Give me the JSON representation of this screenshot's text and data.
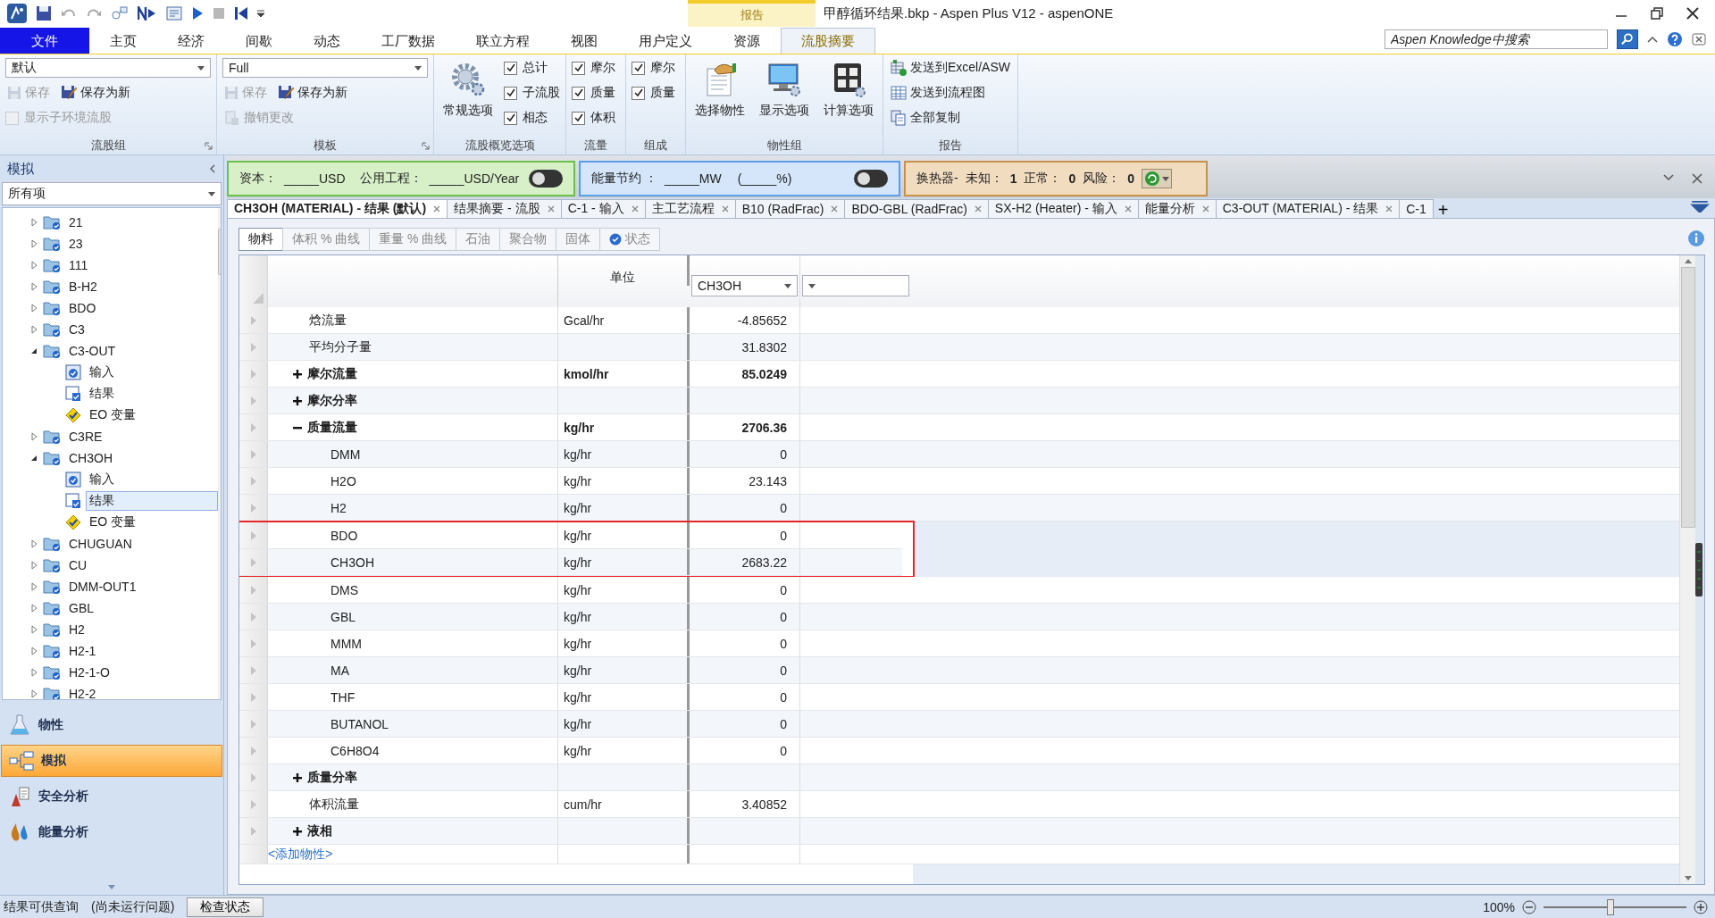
{
  "app_bar": {
    "title": "甲醇循环结果.bkp - Aspen Plus V12 - aspenONE",
    "contextual_tab": "报告"
  },
  "menu_tabs": [
    {
      "label": "文件",
      "kind": "file",
      "selected": false
    },
    {
      "label": "主页",
      "kind": "tab",
      "selected": false
    },
    {
      "label": "经济",
      "kind": "tab",
      "selected": false
    },
    {
      "label": "间歇",
      "kind": "tab",
      "selected": false
    },
    {
      "label": "动态",
      "kind": "tab",
      "selected": false
    },
    {
      "label": "工厂数据",
      "kind": "tab",
      "selected": false
    },
    {
      "label": "联立方程",
      "kind": "tab",
      "selected": false
    },
    {
      "label": "视图",
      "kind": "tab",
      "selected": false
    },
    {
      "label": "用户定义",
      "kind": "tab",
      "selected": false
    },
    {
      "label": "资源",
      "kind": "tab",
      "selected": false
    },
    {
      "label": "流股摘要",
      "kind": "tab",
      "selected": true
    }
  ],
  "search": {
    "placeholder": "Aspen Knowledge中搜索"
  },
  "ribbon": {
    "groups": [
      {
        "title": "流股组",
        "launcher": true,
        "columns": [
          [
            {
              "kind": "dropdown",
              "value": "默认"
            },
            {
              "kind": "button_row",
              "items": [
                {
                  "kind": "button",
                  "label": "保存",
                  "disabled": true
                },
                {
                  "kind": "button",
                  "label": "保存为新",
                  "disabled": false
                }
              ]
            },
            {
              "kind": "checkbox",
              "label": "显示子环境流股",
              "checked": false,
              "disabled": true
            }
          ]
        ]
      },
      {
        "title": "模板",
        "launcher": true,
        "columns": [
          [
            {
              "kind": "dropdown",
              "value": "Full"
            },
            {
              "kind": "button_row",
              "items": [
                {
                  "kind": "button",
                  "label": "保存",
                  "disabled": true
                },
                {
                  "kind": "button",
                  "label": "保存为新",
                  "disabled": false
                }
              ]
            },
            {
              "kind": "button",
              "label": "撤销更改",
              "disabled": true
            }
          ]
        ]
      },
      {
        "title": "流股概览选项",
        "launcher": false,
        "columns": [
          [
            {
              "kind": "large_button",
              "label": "常规选项"
            }
          ],
          [
            {
              "kind": "checkbox",
              "label": "总计",
              "checked": true,
              "disabled": false
            },
            {
              "kind": "checkbox",
              "label": "子流股",
              "checked": true,
              "disabled": false
            },
            {
              "kind": "checkbox",
              "label": "相态",
              "checked": true,
              "disabled": false
            }
          ]
        ]
      },
      {
        "title": "流量",
        "launcher": false,
        "columns": [
          [
            {
              "kind": "checkbox",
              "label": "摩尔",
              "checked": true,
              "disabled": false
            },
            {
              "kind": "checkbox",
              "label": "质量",
              "checked": true,
              "disabled": false
            },
            {
              "kind": "checkbox",
              "label": "体积",
              "checked": true,
              "disabled": false
            }
          ]
        ]
      },
      {
        "title": "组成",
        "launcher": false,
        "columns": [
          [
            {
              "kind": "checkbox",
              "label": "摩尔",
              "checked": true,
              "disabled": false
            },
            {
              "kind": "checkbox",
              "label": "质量",
              "checked": true,
              "disabled": false
            }
          ]
        ]
      },
      {
        "title": "物性组",
        "launcher": false,
        "columns": [
          [
            {
              "kind": "large_button",
              "label": "选择物性"
            }
          ],
          [
            {
              "kind": "large_button",
              "label": "显示选项"
            }
          ],
          [
            {
              "kind": "large_button",
              "label": "计算选项"
            }
          ]
        ]
      },
      {
        "title": "报告",
        "launcher": false,
        "columns": [
          [
            {
              "kind": "button",
              "label": "发送到Excel/ASW",
              "disabled": false
            },
            {
              "kind": "button",
              "label": "发送到流程图",
              "disabled": false
            },
            {
              "kind": "button",
              "label": "全部复制",
              "disabled": false
            }
          ]
        ]
      }
    ]
  },
  "navigator": {
    "title": "模拟",
    "filter": "所有项",
    "tree": [
      {
        "label": "21",
        "expanded": false,
        "selected": false
      },
      {
        "label": "23",
        "expanded": false,
        "selected": false
      },
      {
        "label": "111",
        "expanded": false,
        "selected": false
      },
      {
        "label": "B-H2",
        "expanded": false,
        "selected": false
      },
      {
        "label": "BDO",
        "expanded": false,
        "selected": false
      },
      {
        "label": "C3",
        "expanded": false,
        "selected": false
      },
      {
        "label": "C3-OUT",
        "expanded": true,
        "selected": false,
        "children": [
          {
            "label": "输入",
            "kind": "input",
            "selected": false
          },
          {
            "label": "结果",
            "kind": "results",
            "selected": false
          },
          {
            "label": "EO 变量",
            "kind": "eo",
            "selected": false
          }
        ]
      },
      {
        "label": "C3RE",
        "expanded": false,
        "selected": false
      },
      {
        "label": "CH3OH",
        "expanded": true,
        "selected": false,
        "children": [
          {
            "label": "输入",
            "kind": "input",
            "selected": false
          },
          {
            "label": "结果",
            "kind": "results",
            "selected": true
          },
          {
            "label": "EO 变量",
            "kind": "eo",
            "selected": false
          }
        ]
      },
      {
        "label": "CHUGUAN",
        "expanded": false,
        "selected": false
      },
      {
        "label": "CU",
        "expanded": false,
        "selected": false
      },
      {
        "label": "DMM-OUT1",
        "expanded": false,
        "selected": false
      },
      {
        "label": "GBL",
        "expanded": false,
        "selected": false
      },
      {
        "label": "H2",
        "expanded": false,
        "selected": false
      },
      {
        "label": "H2-1",
        "expanded": false,
        "selected": false
      },
      {
        "label": "H2-1-O",
        "expanded": false,
        "selected": false
      },
      {
        "label": "H2-2",
        "expanded": false,
        "selected": false
      }
    ],
    "sections": [
      {
        "label": "物性",
        "kind": "properties",
        "selected": false
      },
      {
        "label": "模拟",
        "kind": "simulation",
        "selected": true
      },
      {
        "label": "安全分析",
        "kind": "safety",
        "selected": false
      },
      {
        "label": "能量分析",
        "kind": "energy",
        "selected": false
      }
    ]
  },
  "analysis_bar": {
    "capital": {
      "label": "资本：",
      "value": "_____USD"
    },
    "utility": {
      "label": "公用工程：",
      "value": "_____USD/Year"
    },
    "cost_on": false,
    "energy": {
      "label": "能量节约 ：",
      "value": "_____MW",
      "percent": "(_____%)",
      "on": false
    },
    "exchangers": {
      "label": "换热器-",
      "counts": [
        {
          "label": "未知：",
          "value": "1"
        },
        {
          "label": "正常：",
          "value": "0"
        },
        {
          "label": "风险：",
          "value": "0"
        }
      ]
    }
  },
  "document_tabs": [
    {
      "label": "CH3OH (MATERIAL) - 结果 (默认)",
      "selected": true,
      "closable": true
    },
    {
      "label": "结果摘要 - 流股",
      "selected": false,
      "closable": true
    },
    {
      "label": "C-1 - 输入",
      "selected": false,
      "closable": true
    },
    {
      "label": "主工艺流程",
      "selected": false,
      "closable": true
    },
    {
      "label": "B10 (RadFrac)",
      "selected": false,
      "closable": true
    },
    {
      "label": "BDO-GBL (RadFrac)",
      "selected": false,
      "closable": true
    },
    {
      "label": "SX-H2 (Heater) - 输入",
      "selected": false,
      "closable": true
    },
    {
      "label": "能量分析",
      "selected": false,
      "closable": true
    },
    {
      "label": "C3-OUT (MATERIAL) - 结果",
      "selected": false,
      "closable": true
    },
    {
      "label": "C-1",
      "selected": false,
      "closable": false
    }
  ],
  "new_tab": "+",
  "sheet_tabs": [
    {
      "label": "物料",
      "selected": true,
      "kind": "plain"
    },
    {
      "label": "体积 % 曲线",
      "selected": false,
      "kind": "plain"
    },
    {
      "label": "重量 % 曲线",
      "selected": false,
      "kind": "plain"
    },
    {
      "label": "石油",
      "selected": false,
      "kind": "plain"
    },
    {
      "label": "聚合物",
      "selected": false,
      "kind": "plain"
    },
    {
      "label": "固体",
      "selected": false,
      "kind": "plain"
    },
    {
      "label": "状态",
      "selected": false,
      "kind": "status"
    }
  ],
  "grid": {
    "unit_header": "单位",
    "stream_selector": "CH3OH",
    "rows": [
      {
        "name": "焓流量",
        "unit": "Gcal/hr",
        "value": "-4.85652"
      },
      {
        "name": "平均分子量",
        "value": "31.8302"
      },
      {
        "name": "摩尔流量",
        "unit": "kmol/hr",
        "value": "85.0249",
        "expanded": false
      },
      {
        "name": "摩尔分率",
        "expanded": false
      },
      {
        "name": "质量流量",
        "unit": "kg/hr",
        "value": "2706.36",
        "expanded": true,
        "children": [
          {
            "name": "DMM",
            "unit": "kg/hr",
            "value": "0",
            "highlighted": false
          },
          {
            "name": "H2O",
            "unit": "kg/hr",
            "value": "23.143",
            "highlighted": false
          },
          {
            "name": "H2",
            "unit": "kg/hr",
            "value": "0",
            "highlighted": false
          },
          {
            "name": "BDO",
            "unit": "kg/hr",
            "value": "0",
            "highlighted": true
          },
          {
            "name": "CH3OH",
            "unit": "kg/hr",
            "value": "2683.22",
            "highlighted": true
          },
          {
            "name": "DMS",
            "unit": "kg/hr",
            "value": "0",
            "highlighted": false
          },
          {
            "name": "GBL",
            "unit": "kg/hr",
            "value": "0",
            "highlighted": false
          },
          {
            "name": "MMM",
            "unit": "kg/hr",
            "value": "0",
            "highlighted": false
          },
          {
            "name": "MA",
            "unit": "kg/hr",
            "value": "0",
            "highlighted": false
          },
          {
            "name": "THF",
            "unit": "kg/hr",
            "value": "0",
            "highlighted": false
          },
          {
            "name": "BUTANOL",
            "unit": "kg/hr",
            "value": "0",
            "highlighted": false
          },
          {
            "name": "C6H8O4",
            "unit": "kg/hr",
            "value": "0",
            "highlighted": false
          }
        ]
      },
      {
        "name": "质量分率",
        "expanded": false
      },
      {
        "name": "体积流量",
        "unit": "cum/hr",
        "value": "3.40852"
      },
      {
        "name": "液相",
        "expanded": false
      }
    ],
    "add_link": "<添加物性>"
  },
  "status_bar": {
    "message": "结果可供查询",
    "note": "(尚未运行问题)",
    "check_button": "检查状态",
    "zoom": "100%",
    "zoom_level": {
      "level": 0.47
    }
  }
}
